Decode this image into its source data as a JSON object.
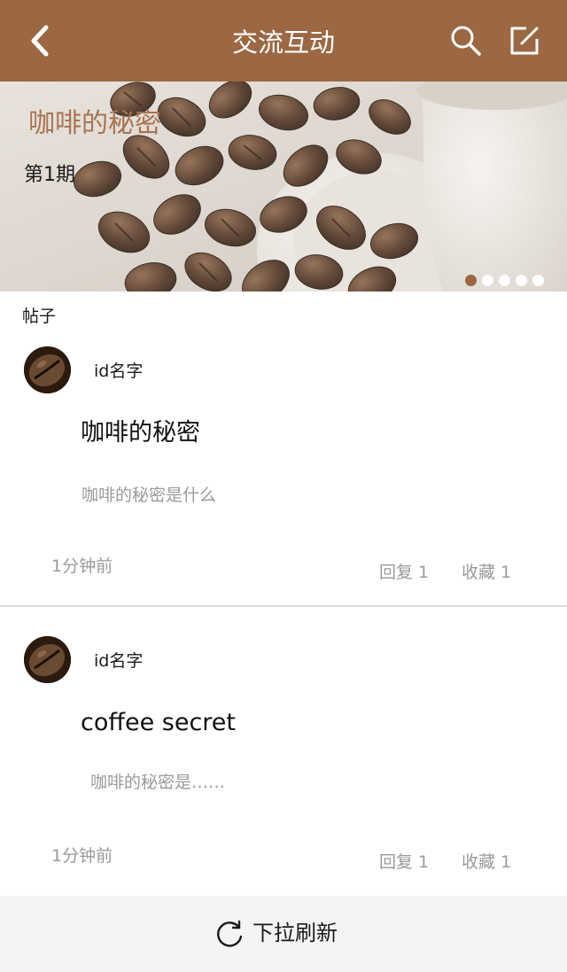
{
  "header": {
    "title": "交流互动",
    "back_icon": "back-arrow-icon",
    "search_icon": "search-icon",
    "edit_icon": "edit-icon",
    "background_color": "#9b6843"
  },
  "banner": {
    "title": "咖啡的秘密",
    "issue": "第1期",
    "title_color": "#a87452",
    "page_indicator": {
      "total": 5,
      "active": 1
    }
  },
  "section": {
    "label": "帖子"
  },
  "posts": [
    {
      "username": "id名字",
      "title": "咖啡的秘密",
      "summary": "咖啡的秘密是什么",
      "time": "1分钟前",
      "reply": "回复 1",
      "favorite": "收藏   1"
    },
    {
      "username": "id名字",
      "title": "coffee  secret",
      "summary": "咖啡的秘密是……",
      "time": "1分钟前",
      "reply": "回复 1",
      "favorite": "收藏   1"
    }
  ],
  "footer": {
    "refresh_label": "下拉刷新",
    "refresh_icon": "refresh-icon"
  }
}
